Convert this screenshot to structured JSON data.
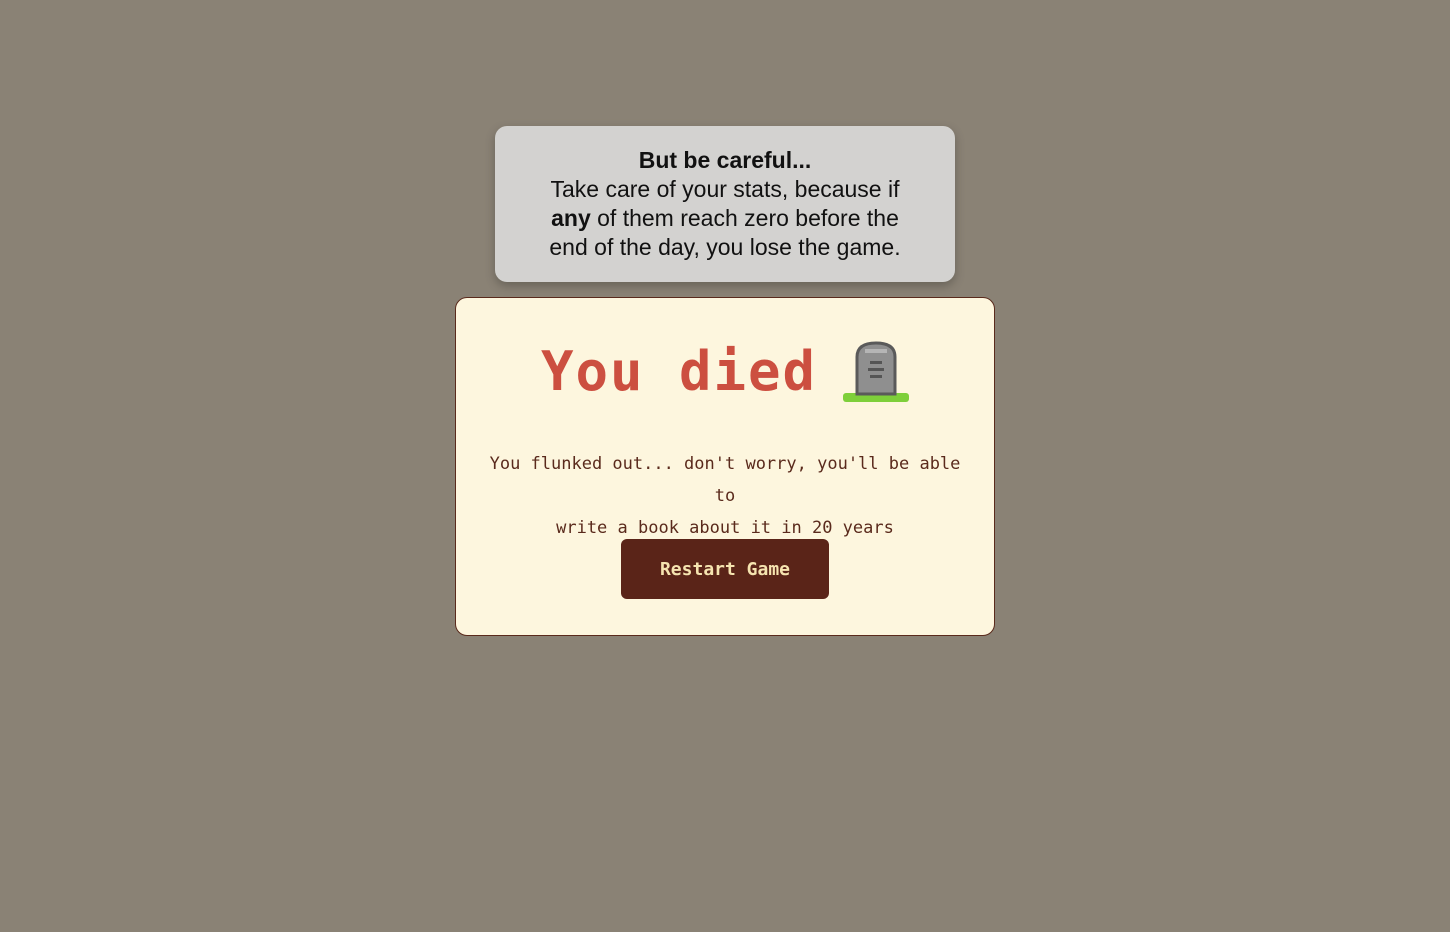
{
  "tooltip": {
    "title": "But be careful...",
    "line1": "Take care of your stats, because if",
    "emphasis": "any",
    "line2_rest": " of them reach zero before the",
    "line3": "end of the day, you lose the game."
  },
  "modal": {
    "heading": "You died",
    "heading_icon": "headstone-icon",
    "message_line1": "You flunked out... don't worry, you'll be able to",
    "message_line2": "write a book about it in 20 years",
    "restart_label": "Restart Game"
  },
  "colors": {
    "background": "#8a8275",
    "tooltip_bg": "#d3d2d0",
    "modal_bg": "#fdf6de",
    "heading": "#cc4f40",
    "text": "#5a2a1c",
    "button_bg": "#5a2418",
    "button_text": "#f6e4b0"
  }
}
